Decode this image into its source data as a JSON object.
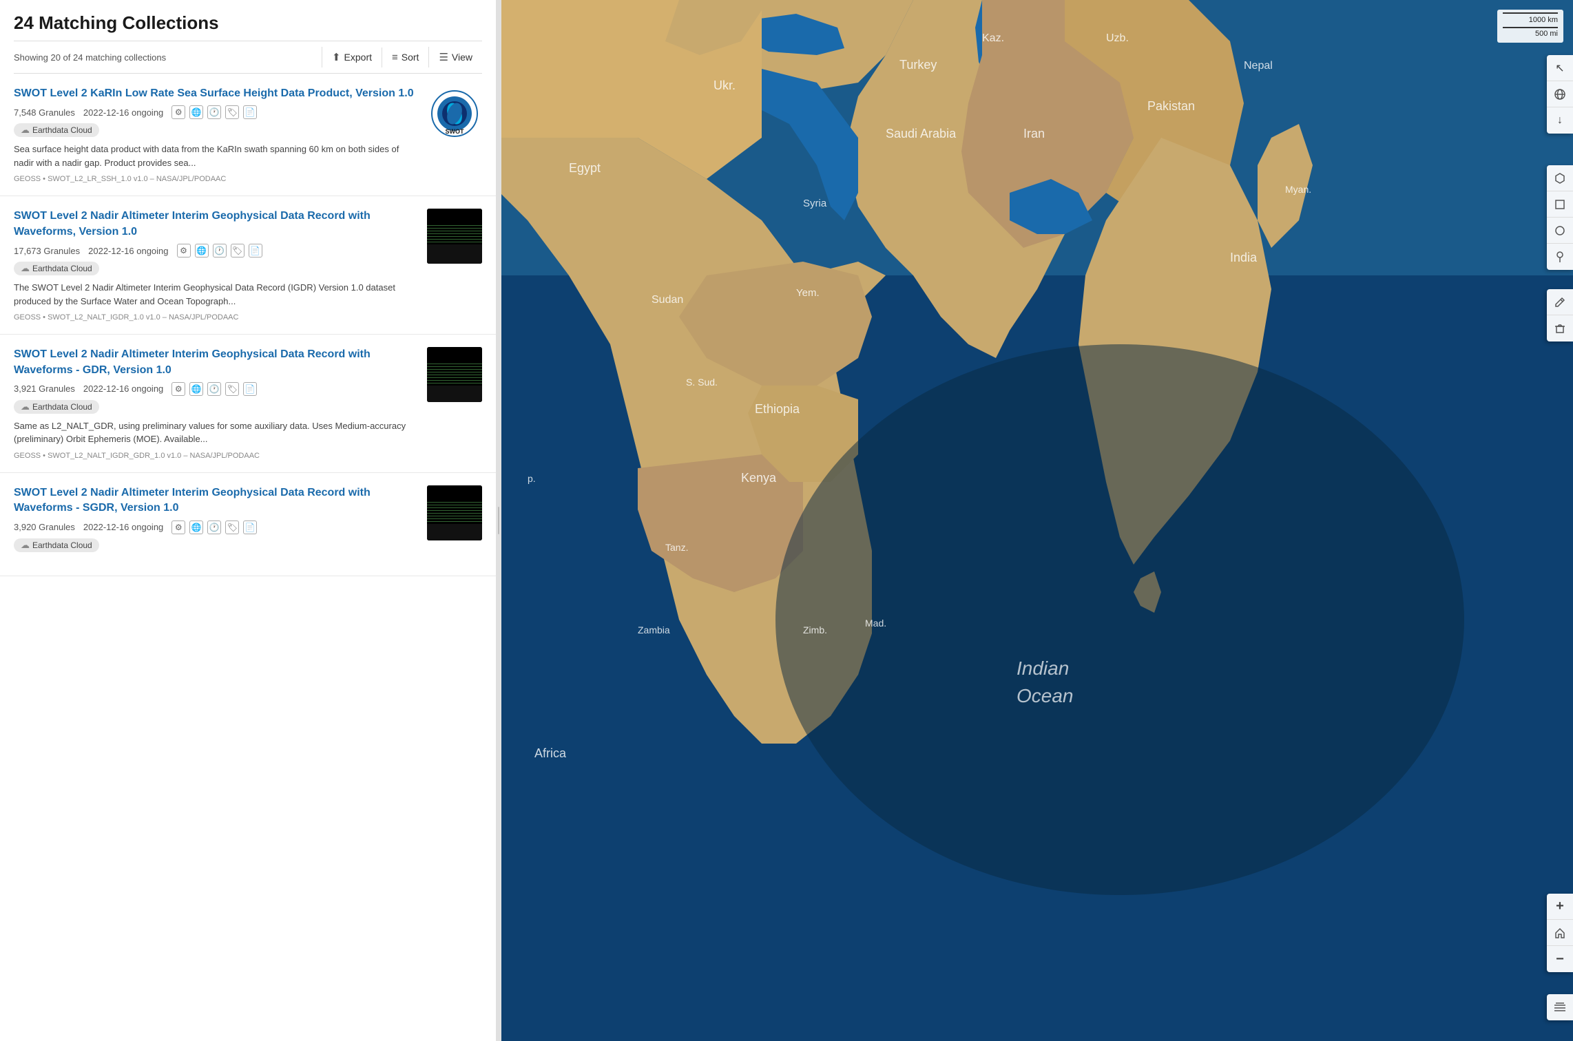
{
  "header": {
    "title": "24 Matching Collections",
    "showing_text": "Showing 20 of 24 matching collections"
  },
  "toolbar": {
    "export_label": "Export",
    "sort_label": "Sort",
    "view_label": "View"
  },
  "collections": [
    {
      "id": 1,
      "title": "SWOT Level 2 KaRIn Low Rate Sea Surface Height Data Product, Version 1.0",
      "granules": "7,548 Granules",
      "date_range": "2022-12-16 ongoing",
      "cloud_badge": "Earthdata Cloud",
      "description": "Sea surface height data product with data from the KaRIn swath spanning 60 km on both sides of nadir with a nadir gap. Product provides sea...",
      "tags": "GEOSS • SWOT_L2_LR_SSH_1.0 v1.0 – NASA/JPL/PODAAC",
      "thumb_type": "swot"
    },
    {
      "id": 2,
      "title": "SWOT Level 2 Nadir Altimeter Interim Geophysical Data Record with Waveforms, Version 1.0",
      "granules": "17,673 Granules",
      "date_range": "2022-12-16 ongoing",
      "cloud_badge": "Earthdata Cloud",
      "description": "The SWOT Level 2 Nadir Altimeter Interim Geophysical Data Record (IGDR) Version 1.0 dataset produced by the Surface Water and Ocean Topograph...",
      "tags": "GEOSS • SWOT_L2_NALT_IGDR_1.0 v1.0 – NASA/JPL/PODAAC",
      "thumb_type": "map"
    },
    {
      "id": 3,
      "title": "SWOT Level 2 Nadir Altimeter Interim Geophysical Data Record with Waveforms - GDR, Version 1.0",
      "granules": "3,921 Granules",
      "date_range": "2022-12-16 ongoing",
      "cloud_badge": "Earthdata Cloud",
      "description": "Same as L2_NALT_GDR, using preliminary values for some auxiliary data. Uses Medium-accuracy (preliminary) Orbit Ephemeris (MOE). Available...",
      "tags": "GEOSS • SWOT_L2_NALT_IGDR_GDR_1.0 v1.0 – NASA/JPL/PODAAC",
      "thumb_type": "map"
    },
    {
      "id": 4,
      "title": "SWOT Level 2 Nadir Altimeter Interim Geophysical Data Record with Waveforms - SGDR, Version 1.0",
      "granules": "3,920 Granules",
      "date_range": "2022-12-16 ongoing",
      "cloud_badge": "Earthdata Cloud",
      "description": "",
      "tags": "",
      "thumb_type": "map"
    }
  ],
  "map": {
    "scale_km": "1000 km",
    "scale_mi": "500 mi"
  },
  "map_tools": {
    "cursor": "↖",
    "globe": "🌐",
    "arrow_down": "↓",
    "hexagon": "⬡",
    "square": "□",
    "circle": "○",
    "pin": "📍",
    "edit": "✏",
    "delete": "🗑",
    "zoom_in": "+",
    "home": "⌂",
    "zoom_out": "−",
    "layers": "⧉"
  }
}
